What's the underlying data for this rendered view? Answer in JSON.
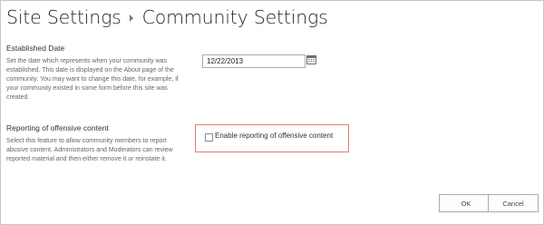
{
  "breadcrumb": {
    "parent": "Site Settings",
    "current": "Community Settings"
  },
  "established_date": {
    "heading": "Established Date",
    "description": "Set the date which represents when your community was established. This date is displayed on the About page of the community. You may want to change this date, for example, if your community existed in some form before this site was created.",
    "value": "12/22/2013"
  },
  "reporting": {
    "heading": "Reporting of offensive content",
    "description": "Select this feature to allow community members to report abusive content. Administrators and Moderators can review reported material and then either remove it or reinstate it.",
    "checkbox_label": "Enable reporting of offensive content",
    "checked": false
  },
  "buttons": {
    "ok": "OK",
    "cancel": "Cancel"
  },
  "colors": {
    "highlight_border": "#e07b7b"
  }
}
